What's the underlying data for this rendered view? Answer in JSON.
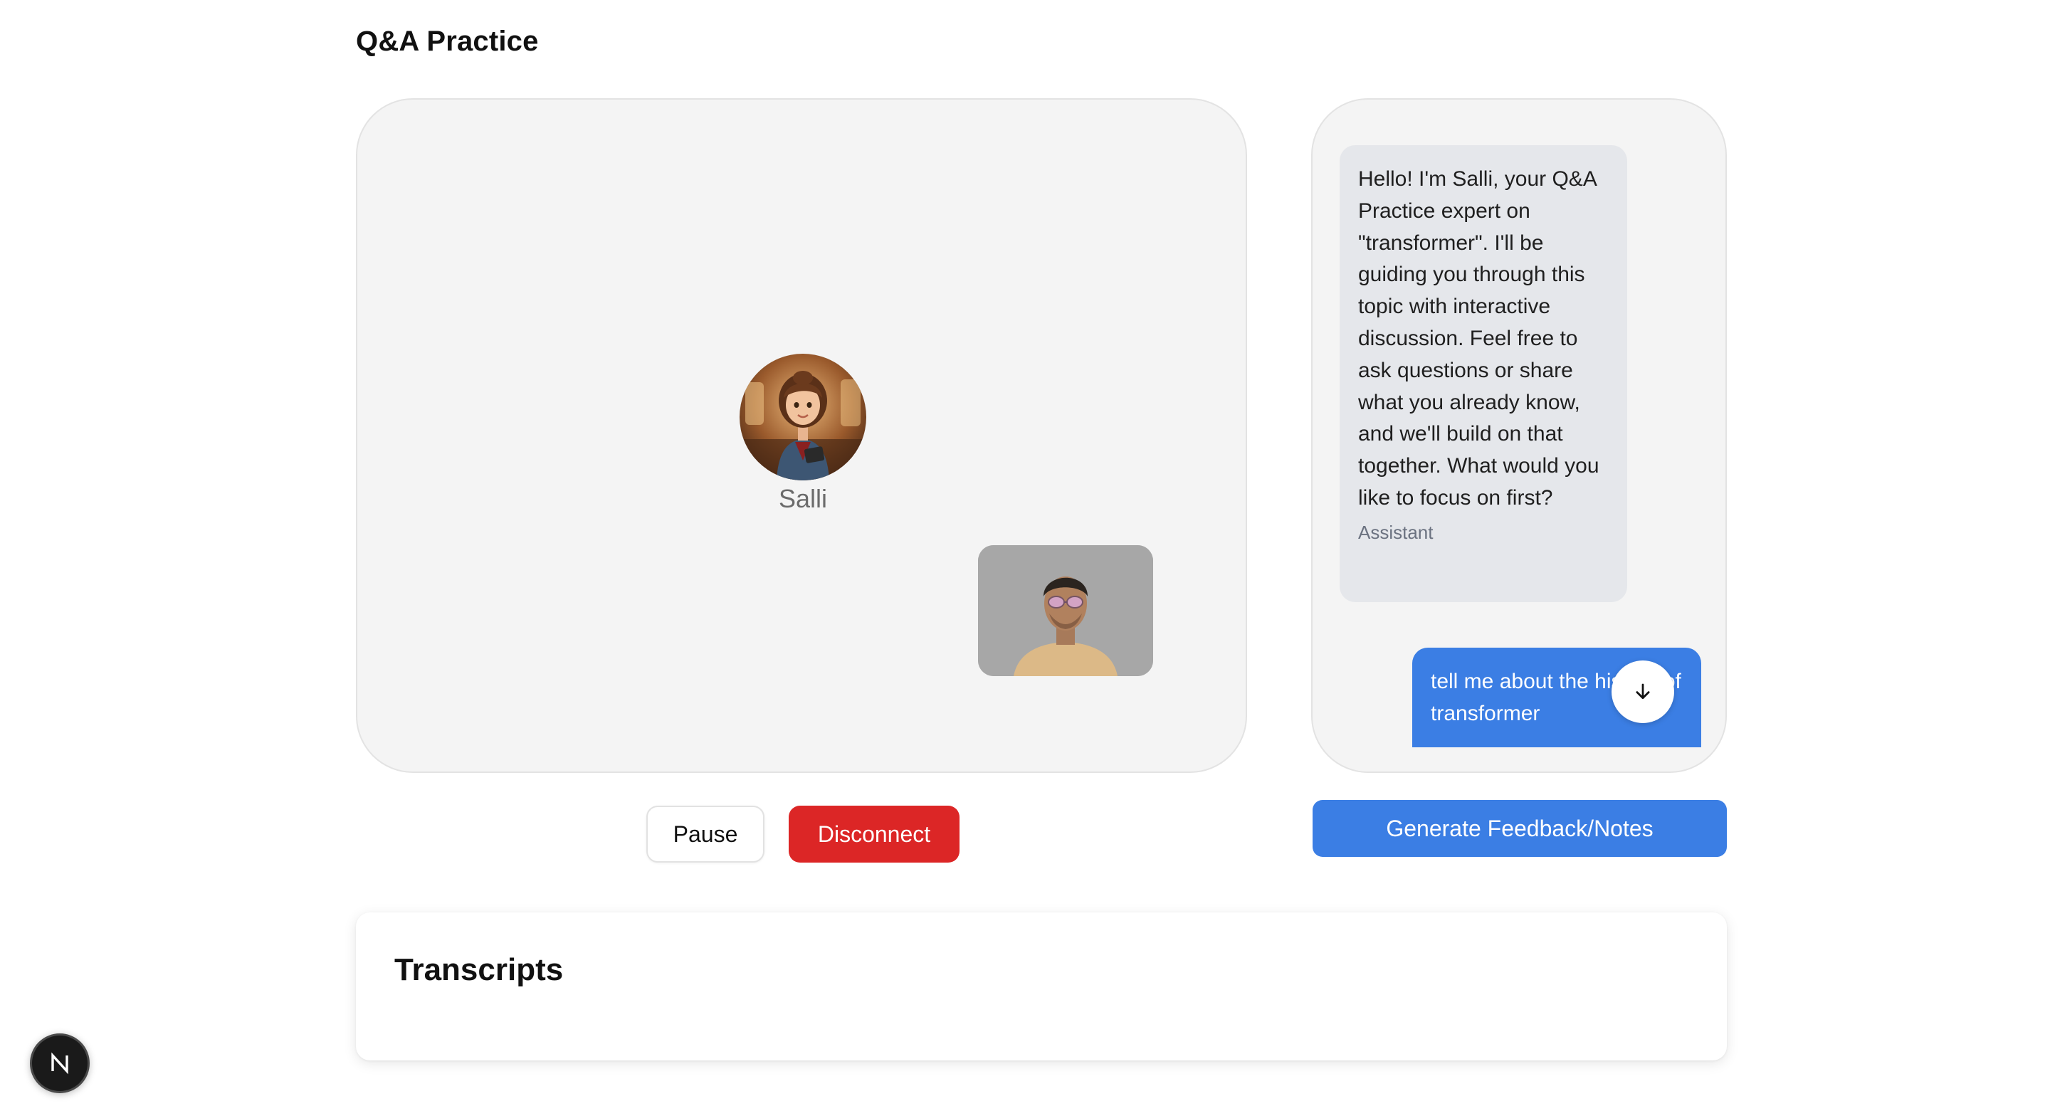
{
  "page": {
    "title": "Q&A Practice"
  },
  "call": {
    "assistant_name": "Salli",
    "controls": {
      "pause_label": "Pause",
      "disconnect_label": "Disconnect"
    }
  },
  "chat": {
    "messages": [
      {
        "role": "Assistant",
        "text": "Hello! I'm Salli, your Q&A Practice expert on \"transformer\". I'll be guiding you through this topic with interactive discussion. Feel free to ask questions or share what you already know, and we'll build on that together. What would you like to focus on first?"
      },
      {
        "role": "user",
        "text": "tell me about the history of transformer"
      }
    ],
    "feedback_button_label": "Generate Feedback/Notes"
  },
  "transcripts": {
    "title": "Transcripts"
  },
  "dev_badge": {
    "letter": "N"
  },
  "colors": {
    "primary_blue": "#3b7ee4",
    "danger_red": "#dc2626",
    "panel_bg": "#f4f4f4",
    "assistant_bubble": "#e5e7eb"
  },
  "icons": {
    "scroll_down": "arrow-down-icon",
    "dev_badge": "nextjs-logo-icon"
  }
}
